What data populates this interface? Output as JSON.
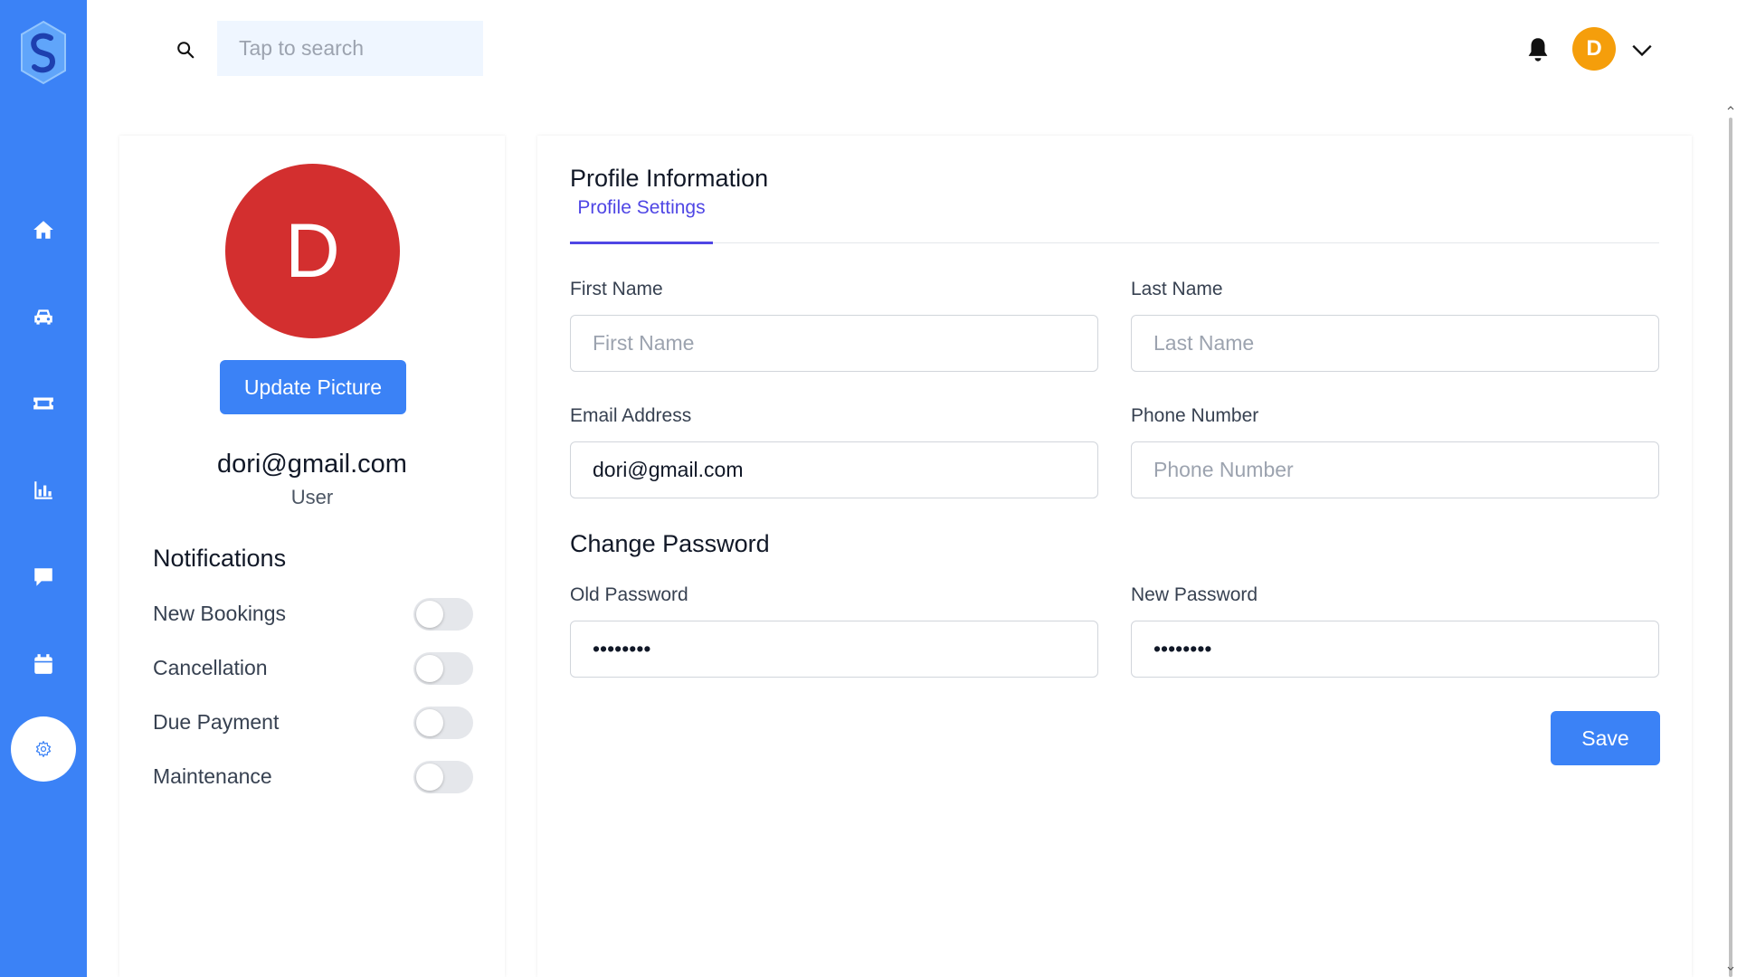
{
  "app": {
    "logo_icon": "s-hexagon-logo",
    "brand_color": "#3b82f6"
  },
  "sidebar": {
    "items": [
      {
        "icon": "home-icon",
        "active": false
      },
      {
        "icon": "car-icon",
        "active": false
      },
      {
        "icon": "ticket-icon",
        "active": false
      },
      {
        "icon": "bar-chart-icon",
        "active": false
      },
      {
        "icon": "chat-icon",
        "active": false
      },
      {
        "icon": "calendar-icon",
        "active": false
      },
      {
        "icon": "gear-icon",
        "active": true
      }
    ]
  },
  "header": {
    "search_placeholder": "Tap to search",
    "avatar_initial": "D",
    "avatar_color": "#f59e0b"
  },
  "profile": {
    "avatar_initial": "D",
    "avatar_color": "#d32f2f",
    "update_picture_label": "Update Picture",
    "email": "dori@gmail.com",
    "role": "User"
  },
  "notifications": {
    "title": "Notifications",
    "items": [
      {
        "label": "New Bookings",
        "enabled": false
      },
      {
        "label": "Cancellation",
        "enabled": false
      },
      {
        "label": "Due Payment",
        "enabled": false
      },
      {
        "label": "Maintenance",
        "enabled": false
      }
    ]
  },
  "form": {
    "title": "Profile Information",
    "tab_label": "Profile Settings",
    "first_name": {
      "label": "First Name",
      "placeholder": "First Name",
      "value": ""
    },
    "last_name": {
      "label": "Last Name",
      "placeholder": "Last Name",
      "value": ""
    },
    "email": {
      "label": "Email Address",
      "placeholder": "Email Address",
      "value": "dori@gmail.com"
    },
    "phone": {
      "label": "Phone Number",
      "placeholder": "Phone Number",
      "value": ""
    },
    "password_section_title": "Change Password",
    "old_password": {
      "label": "Old Password",
      "value": "********"
    },
    "new_password": {
      "label": "New Password",
      "value": "********"
    },
    "save_label": "Save"
  }
}
